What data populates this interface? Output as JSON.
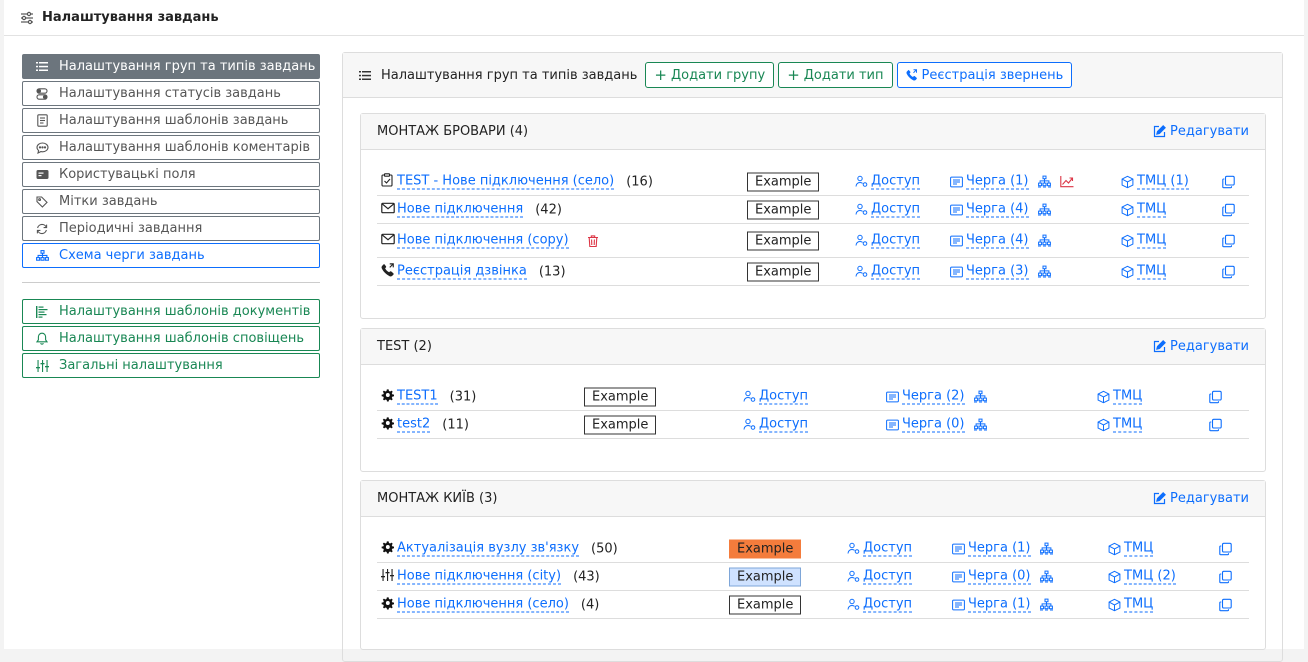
{
  "header": {
    "title": "Налаштування завдань"
  },
  "sidebar": {
    "items": [
      {
        "label": "Налаштування груп та типів завдань",
        "icon": "list-icon",
        "style": "active"
      },
      {
        "label": "Налаштування статусів завдань",
        "icon": "toggle-icon",
        "style": "default"
      },
      {
        "label": "Налаштування шаблонів завдань",
        "icon": "file-text-icon",
        "style": "default"
      },
      {
        "label": "Налаштування шаблонів коментарів",
        "icon": "chat-icon",
        "style": "default"
      },
      {
        "label": "Користувацькі поля",
        "icon": "input-field-icon",
        "style": "default"
      },
      {
        "label": "Мітки завдань",
        "icon": "tag-icon",
        "style": "default"
      },
      {
        "label": "Періодичні завдання",
        "icon": "refresh-icon",
        "style": "default"
      },
      {
        "label": "Схема черги завдань",
        "icon": "diagram-icon",
        "style": "blue"
      }
    ],
    "secondary": [
      {
        "label": "Налаштування шаблонів документів",
        "icon": "document-lines-icon"
      },
      {
        "label": "Налаштування шаблонів сповіщень",
        "icon": "bell-icon"
      },
      {
        "label": "Загальні налаштування",
        "icon": "sliders-icon"
      }
    ]
  },
  "panel": {
    "title": "Налаштування груп та типів завдань",
    "buttons": {
      "add_group": "Додати групу",
      "add_type": "Додати тип",
      "register": "Реєстрація звернень"
    }
  },
  "common": {
    "edit": "Редагувати",
    "access": "Доступ",
    "tmc": "ТМЦ",
    "example": "Example"
  },
  "groups": [
    {
      "title": "МОНТАЖ БРОВАРИ (4)",
      "rows": [
        {
          "icon": "clipboard-check-icon",
          "name": "TEST - Нове підключення (село)",
          "count": "(16)",
          "queue": "Черга (1)",
          "tmc": "ТМЦ (1)",
          "chart": true,
          "trash": false,
          "example_style": "plain"
        },
        {
          "icon": "envelope-icon",
          "name": "Нове підключення",
          "count": "(42)",
          "queue": "Черга (4)",
          "tmc": "ТМЦ",
          "chart": false,
          "trash": false,
          "example_style": "plain"
        },
        {
          "icon": "envelope-icon",
          "name": "Нове підключення (copy)",
          "count": "",
          "queue": "Черга (4)",
          "tmc": "ТМЦ",
          "chart": false,
          "trash": true,
          "example_style": "plain"
        },
        {
          "icon": "phone-icon",
          "name": "Реєстрація дзвінка",
          "count": "(13)",
          "queue": "Черга (3)",
          "tmc": "ТМЦ",
          "chart": false,
          "trash": false,
          "example_style": "plain"
        }
      ]
    },
    {
      "title": "TEST (2)",
      "rows": [
        {
          "icon": "gear-icon",
          "name": "TEST1",
          "count": "(31)",
          "queue": "Черга (2)",
          "tmc": "ТМЦ",
          "chart": false,
          "trash": false,
          "example_style": "plain"
        },
        {
          "icon": "gear-icon",
          "name": "test2",
          "count": "(11)",
          "queue": "Черга (0)",
          "tmc": "ТМЦ",
          "chart": false,
          "trash": false,
          "example_style": "plain"
        }
      ]
    },
    {
      "title": "МОНТАЖ КИЇВ (3)",
      "rows": [
        {
          "icon": "gear-icon",
          "name": "Актуалізація вузлу зв'язку",
          "count": "(50)",
          "queue": "Черга (1)",
          "tmc": "ТМЦ",
          "chart": false,
          "trash": false,
          "example_style": "orange"
        },
        {
          "icon": "sliders-icon",
          "name": "Нове підключення (city)",
          "count": "(43)",
          "queue": "Черга (0)",
          "tmc": "ТМЦ (2)",
          "chart": false,
          "trash": false,
          "example_style": "light"
        },
        {
          "icon": "gear-icon",
          "name": "Нове підключення (село)",
          "count": "(4)",
          "queue": "Черга (1)",
          "tmc": "ТМЦ",
          "chart": false,
          "trash": false,
          "example_style": "plain"
        }
      ]
    }
  ]
}
